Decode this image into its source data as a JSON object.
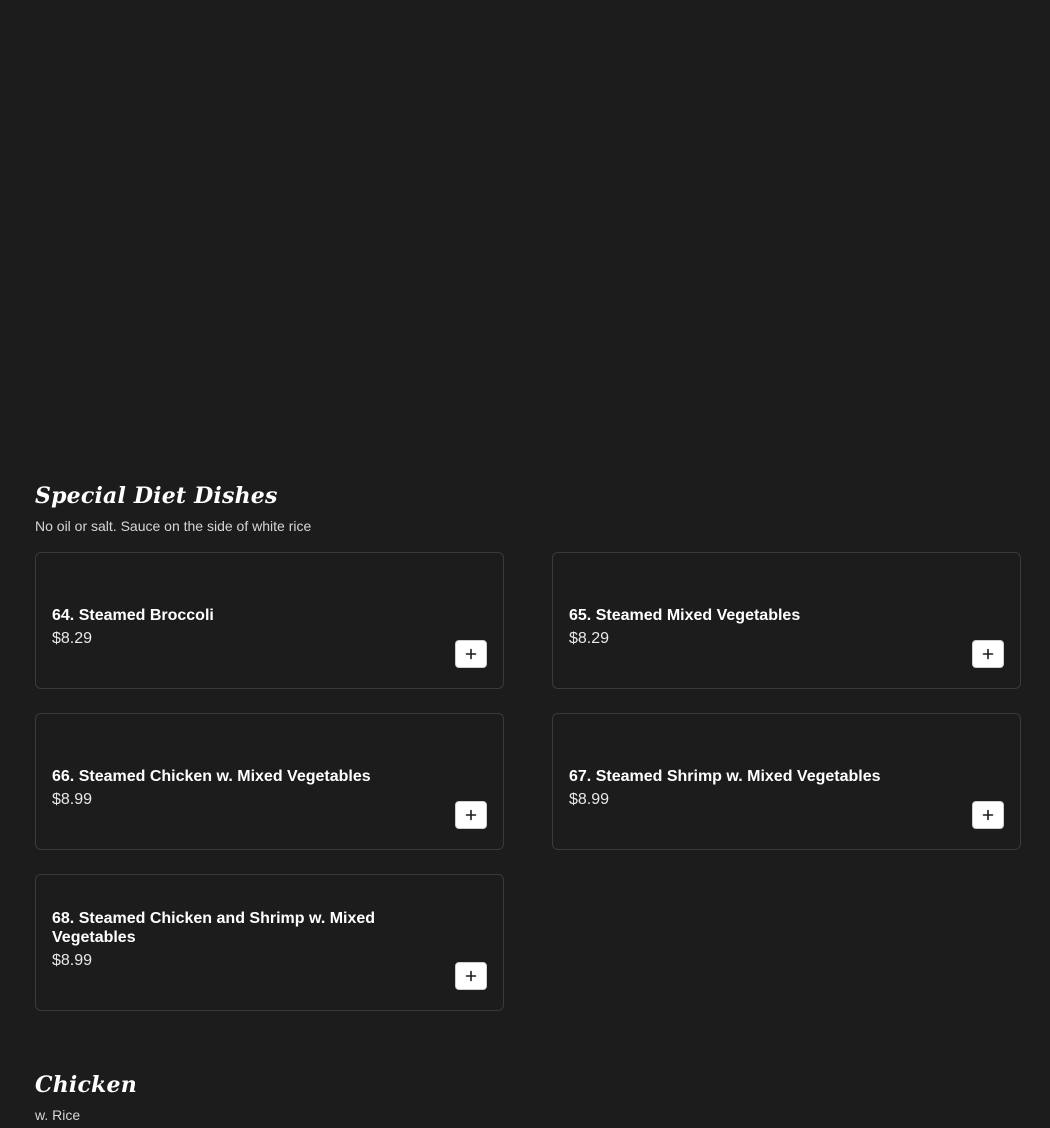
{
  "sections": [
    {
      "title": "Special Diet Dishes",
      "subtitle": "No oil or salt. Sauce on the side of white rice",
      "items": [
        {
          "name": "64. Steamed Broccoli",
          "price": "$8.29"
        },
        {
          "name": "65. Steamed Mixed Vegetables",
          "price": "$8.29"
        },
        {
          "name": "66. Steamed Chicken w. Mixed Vegetables",
          "price": "$8.99"
        },
        {
          "name": "67. Steamed Shrimp w. Mixed Vegetables",
          "price": "$8.99"
        },
        {
          "name": "68. Steamed Chicken and Shrimp w. Mixed Vegetables",
          "price": "$8.99"
        }
      ]
    },
    {
      "title": "Chicken",
      "subtitle": "w. Rice"
    }
  ],
  "icons": {
    "add": "plus-icon"
  },
  "colors": {
    "background": "#1c1c1c",
    "card_border": "#3a3a3a",
    "text": "#ffffff",
    "button_bg": "#ffffff"
  }
}
